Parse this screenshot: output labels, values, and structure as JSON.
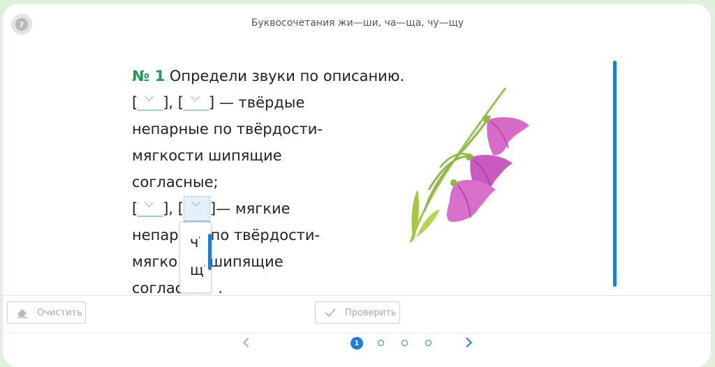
{
  "header": {
    "title": "Буквосочетания жи—ши, ча—ща, чу—щу",
    "help_label": "?"
  },
  "exercise": {
    "number": "№ 1",
    "instruction": "Определи звуки по описанию.",
    "bracket_open": "[",
    "bracket_sep": "], [",
    "bracket_close_hard": "] — твёрдые",
    "bracket_close_soft": "]— мягкие",
    "hard_line2": "непарные по твёрдости-",
    "hard_line3": "мягкости шипящие",
    "hard_line4": "согласные;",
    "soft_line2_a": "непар",
    "soft_line2_b": "по твёрдости-",
    "soft_line3_a": "мягко",
    "soft_line3_b": "шипящие",
    "soft_line4_a": "соглас",
    "soft_line4_b": "."
  },
  "dropdown": {
    "options": [
      {
        "letter": "ч",
        "mark": "'"
      },
      {
        "letter": "щ",
        "mark": "'"
      }
    ]
  },
  "toolbar": {
    "clear_label": "Очистить",
    "check_label": "Проверить"
  },
  "pager": {
    "current_label": "1",
    "pages": 4,
    "current": 1
  },
  "colors": {
    "accent": "#1a7fd8",
    "number": "#1f9a56",
    "background": "#dff0dc"
  }
}
